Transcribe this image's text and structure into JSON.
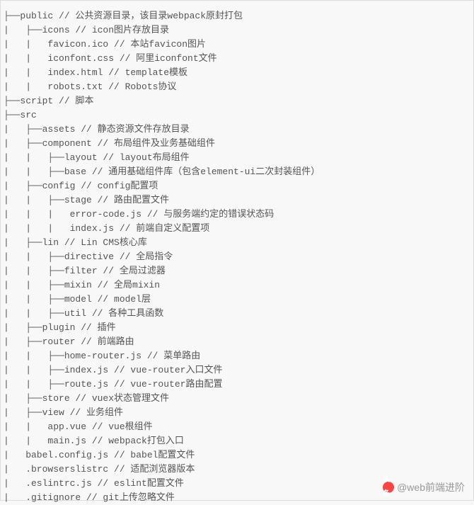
{
  "lines": [
    "├──public // 公共资源目录，该目录webpack原封打包",
    "|   ├──icons // icon图片存放目录",
    "|   |   favicon.ico // 本站favicon图片",
    "|   |   iconfont.css // 阿里iconfont文件",
    "|   |   index.html // template模板",
    "|   |   robots.txt // Robots协议",
    "├──script // 脚本",
    "├──src",
    "|   ├──assets // 静态资源文件存放目录",
    "|   ├──component // 布局组件及业务基础组件",
    "|   |   ├──layout // layout布局组件",
    "|   |   ├──base // 通用基础组件库（包含element-ui二次封装组件）",
    "|   ├──config // config配置项",
    "|   |   ├──stage // 路由配置文件",
    "|   |   |   error-code.js // 与服务端约定的错误状态码",
    "|   |   |   index.js // 前端自定义配置项",
    "|   ├──lin // Lin CMS核心库",
    "|   |   ├──directive // 全局指令",
    "|   |   ├──filter // 全局过滤器",
    "|   |   ├──mixin // 全局mixin",
    "|   |   ├──model // model层",
    "|   |   ├──util // 各种工具函数",
    "|   ├──plugin // 插件",
    "|   ├──router // 前端路由",
    "|   |   ├──home-router.js // 菜单路由",
    "|   |   ├──index.js // vue-router入口文件",
    "|   |   ├──route.js // vue-router路由配置",
    "|   ├──store // vuex状态管理文件",
    "|   ├──view // 业务组件",
    "|   |   app.vue // vue根组件",
    "|   |   main.js // webpack打包入口",
    "|   babel.config.js // babel配置文件",
    "|   .browserslistrc // 适配浏览器版本",
    "|   .eslintrc.js // eslint配置文件",
    "|   .gitignore // git上传忽略文件"
  ],
  "watermark": {
    "prefix": "头条",
    "text": "@web前端进阶"
  }
}
